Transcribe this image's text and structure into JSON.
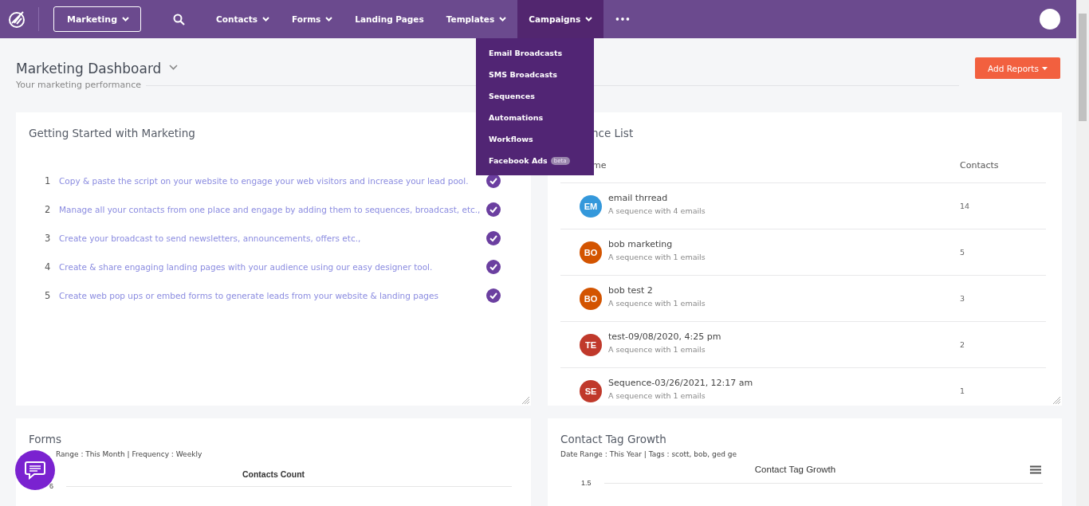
{
  "workspace_select": {
    "value": "Marketing"
  },
  "nav": [
    {
      "label": "Contacts",
      "has_menu": true,
      "selected": false
    },
    {
      "label": "Forms",
      "has_menu": true,
      "selected": false
    },
    {
      "label": "Landing Pages",
      "has_menu": false,
      "selected": false
    },
    {
      "label": "Templates",
      "has_menu": true,
      "selected": false
    },
    {
      "label": "Campaigns",
      "has_menu": true,
      "selected": true
    }
  ],
  "more_menu": "•••",
  "campaigns_menu": [
    {
      "label": "Email Broadcasts"
    },
    {
      "label": "SMS Broadcasts"
    },
    {
      "label": "Sequences"
    },
    {
      "label": "Automations"
    },
    {
      "label": "Workflows"
    },
    {
      "label": "Facebook Ads",
      "badge": "beta"
    }
  ],
  "page": {
    "title": "Marketing Dashboard",
    "subtitle": "Your marketing performance",
    "add_button": "Add Reports"
  },
  "getting_started": {
    "title": "Getting Started with Marketing",
    "steps": [
      {
        "number": "1",
        "text": "Copy & paste the script on your website to engage your web visitors and increase your lead pool.",
        "done": true
      },
      {
        "number": "2",
        "text": "Manage all your contacts from one place and engage by adding them to sequences, broadcast, etc.,",
        "done": true
      },
      {
        "number": "3",
        "text": "Create your broadcast to send newsletters, announcements, offers etc.,",
        "done": true
      },
      {
        "number": "4",
        "text": "Create & share engaging landing pages with your audience using our easy designer tool.",
        "done": true
      },
      {
        "number": "5",
        "text": "Create web pop ups or embed forms to generate leads from your website & landing pages",
        "done": true
      }
    ]
  },
  "sequence_list": {
    "title": "nce List",
    "columns": [
      "me",
      "Contacts"
    ],
    "rows": [
      {
        "initials": "EM",
        "color": "#3498db",
        "name": "email thrread",
        "description": "A sequence with 4 emails",
        "contacts": "14"
      },
      {
        "initials": "BO",
        "color": "#d35400",
        "name": "bob marketing",
        "description": "A sequence with 1 emails",
        "contacts": "5"
      },
      {
        "initials": "BO",
        "color": "#d35400",
        "name": "bob test 2",
        "description": "A sequence with 1 emails",
        "contacts": "3"
      },
      {
        "initials": "TE",
        "color": "#c0392b",
        "name": "test-09/08/2020, 4:25 pm",
        "description": "A sequence with 1 emails",
        "contacts": "2"
      },
      {
        "initials": "SE",
        "color": "#c0392b",
        "name": "Sequence-03/26/2021, 12:17 am",
        "description": "A sequence with 1 emails",
        "contacts": "1"
      }
    ]
  },
  "forms": {
    "title": "Forms",
    "filters": "Range : This Month | Frequency : Weekly",
    "chart_title": "Contacts Count",
    "y_tick": "6"
  },
  "tag_growth": {
    "title": "Contact Tag Growth",
    "filters": "Date Range : This Year | Tags : scott, bob, ged ge",
    "chart_title": "Contact Tag Growth",
    "y_tick": "1.5"
  }
}
